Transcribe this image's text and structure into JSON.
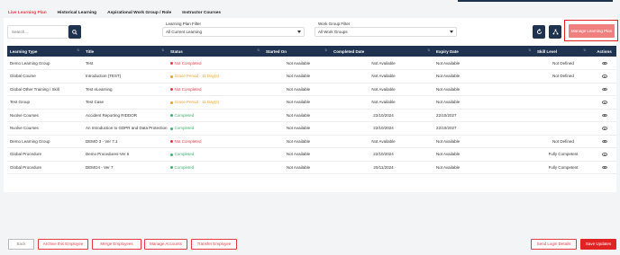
{
  "tabs": [
    {
      "label": "Live Learning Plan",
      "active": true
    },
    {
      "label": "Historical Learning",
      "active": false
    },
    {
      "label": "Aspirational Work Group / Role",
      "active": false
    },
    {
      "label": "Instructor Courses",
      "active": false
    }
  ],
  "search": {
    "placeholder": "Search..."
  },
  "filters": {
    "learning_plan": {
      "label": "Learning Plan Filter",
      "value": "All Current Learning"
    },
    "work_group": {
      "label": "Work Group Filter",
      "value": "All Work Groups"
    }
  },
  "actions": {
    "manage_label": "Manage Learning Plan"
  },
  "colors": {
    "accent": "#e63946",
    "header": "#1f3350",
    "not_completed": "#e63946",
    "overdue": "#f0a030",
    "completed": "#3cb371"
  },
  "table": {
    "headers": [
      "Learning Type",
      "Title",
      "Status",
      "Started On",
      "Completed Date",
      "Expiry Date",
      "Skill Level",
      "Actions"
    ],
    "rows": [
      {
        "type": "Demo Learning Group",
        "title": "Test",
        "status": "Not Completed",
        "status_kind": "not_completed",
        "started": "Not Available",
        "completed": "Not Available",
        "expiry": "Not Available",
        "skill": "Not Defined"
      },
      {
        "type": "Global Course",
        "title": "Introduction (TEST)",
        "status": "Grace Period - 11 Day(s)",
        "status_kind": "overdue",
        "started": "Not Available",
        "completed": "Not Available",
        "expiry": "Not Available",
        "skill": "Not Defined"
      },
      {
        "type": "Global Other Training / Skill",
        "title": "Test eLearning",
        "status": "Not Completed",
        "status_kind": "not_completed",
        "started": "Not Available",
        "completed": "Not Available",
        "expiry": "Not Available",
        "skill": ""
      },
      {
        "type": "Test Group",
        "title": "Test Case",
        "status": "Grace Period - 11 Day(s)",
        "status_kind": "overdue",
        "started": "Not Available",
        "completed": "Not Available",
        "expiry": "Not Available",
        "skill": ""
      },
      {
        "type": "Nvolve Courses",
        "title": "Accident Reporting RIDDOR",
        "status": "Completed",
        "status_kind": "completed",
        "started": "Not Available",
        "completed": "22/10/2024",
        "expiry": "22/10/2027",
        "skill": ""
      },
      {
        "type": "Nvolve Courses",
        "title": "An Introduction to GDPR and Data Protection",
        "status": "Completed",
        "status_kind": "completed",
        "started": "Not Available",
        "completed": "22/10/2024",
        "expiry": "22/10/2027",
        "skill": ""
      },
      {
        "type": "Demo Learning Group",
        "title": "DEMO 3 - Ver 7.1",
        "status": "Not Completed",
        "status_kind": "not_completed",
        "started": "Not Available",
        "completed": "Not Available",
        "expiry": "Not Available",
        "skill": "Not Defined"
      },
      {
        "type": "Global Procedure",
        "title": "Demo Procedures-Ver 6",
        "status": "Completed",
        "status_kind": "completed",
        "started": "Not Available",
        "completed": "22/10/2024",
        "expiry": "Not Available",
        "skill": "Fully Competent"
      },
      {
        "type": "Global Procedure",
        "title": "DEMO4 - Ver 7",
        "status": "Completed",
        "status_kind": "completed",
        "started": "Not Available",
        "completed": "20/11/2024",
        "expiry": "Not Available",
        "skill": "Fully Competent"
      }
    ]
  },
  "bottom": {
    "back": "Back",
    "archive": "Archive this Employee",
    "merge": "Merge Employees",
    "manage_accounts": "Manage Accounts",
    "transfer": "Transfer Employee",
    "send_login": "Send Login Details",
    "save": "Save Updates"
  }
}
